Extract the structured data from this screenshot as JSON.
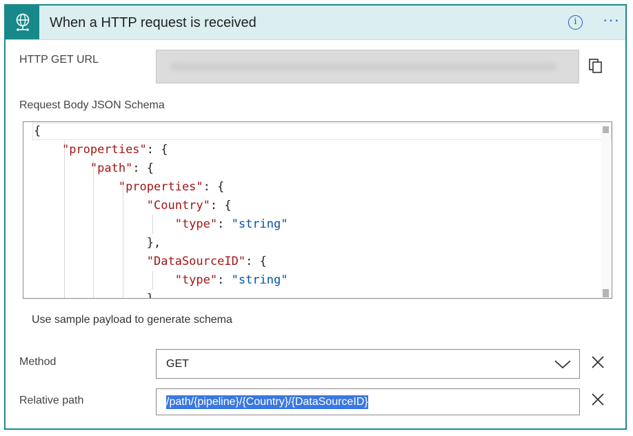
{
  "header": {
    "title": "When a HTTP request is received",
    "info_label": "i",
    "more_label": "···",
    "accent_color": "#17898b"
  },
  "http_get_url": {
    "label": "HTTP GET URL"
  },
  "schema": {
    "label": "Request Body JSON Schema",
    "lines": [
      [
        {
          "t": "{",
          "c": ""
        }
      ],
      [
        {
          "t": "    ",
          "c": ""
        },
        {
          "t": "\"properties\"",
          "c": "k"
        },
        {
          "t": ": {",
          "c": ""
        }
      ],
      [
        {
          "t": "        ",
          "c": ""
        },
        {
          "t": "\"path\"",
          "c": "k"
        },
        {
          "t": ": {",
          "c": ""
        }
      ],
      [
        {
          "t": "            ",
          "c": ""
        },
        {
          "t": "\"properties\"",
          "c": "k"
        },
        {
          "t": ": {",
          "c": ""
        }
      ],
      [
        {
          "t": "                ",
          "c": ""
        },
        {
          "t": "\"Country\"",
          "c": "k"
        },
        {
          "t": ": {",
          "c": ""
        }
      ],
      [
        {
          "t": "                    ",
          "c": ""
        },
        {
          "t": "\"type\"",
          "c": "k"
        },
        {
          "t": ": ",
          "c": ""
        },
        {
          "t": "\"string\"",
          "c": "s"
        }
      ],
      [
        {
          "t": "                },",
          "c": ""
        }
      ],
      [
        {
          "t": "                ",
          "c": ""
        },
        {
          "t": "\"DataSourceID\"",
          "c": "k"
        },
        {
          "t": ": {",
          "c": ""
        }
      ],
      [
        {
          "t": "                    ",
          "c": ""
        },
        {
          "t": "\"type\"",
          "c": "k"
        },
        {
          "t": ": ",
          "c": ""
        },
        {
          "t": "\"string\"",
          "c": "s"
        }
      ],
      [
        {
          "t": "                }",
          "c": ""
        }
      ]
    ]
  },
  "sample_payload_link": "Use sample payload to generate schema",
  "method": {
    "label": "Method",
    "value": "GET"
  },
  "relative_path": {
    "label": "Relative path",
    "value": "/path/{pipeline}/{Country}/{DataSourceID}"
  }
}
